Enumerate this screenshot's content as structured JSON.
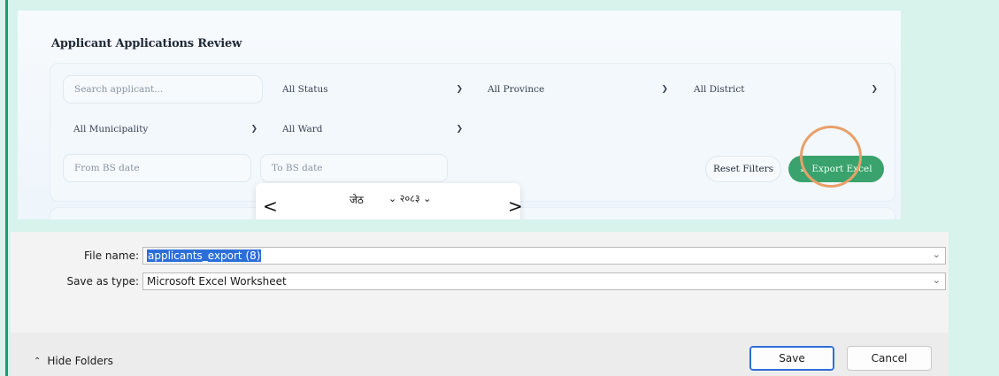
{
  "app": {
    "title": "Applicant Applications Review",
    "search_placeholder": "Search applicant...",
    "filters": {
      "status": "All Status",
      "province": "All Province",
      "district": "All District",
      "municipality": "All Municipality",
      "ward": "All Ward"
    },
    "from_date_placeholder": "From BS date",
    "to_date_placeholder": "To BS date",
    "reset_label": "Reset Filters",
    "export_label": "Export Excel",
    "calendar": {
      "prev": "<",
      "next": ">",
      "month": "जेठ",
      "year": "२०८३"
    }
  },
  "dialog": {
    "file_name_label": "File name:",
    "file_name_value": "applicants_export (8)",
    "save_type_label": "Save as type:",
    "save_type_value": "Microsoft Excel Worksheet",
    "hide_folders_label": "Hide Folders",
    "save_label": "Save",
    "cancel_label": "Cancel"
  },
  "icons": {
    "chevron": "chevron-down-icon",
    "export": "download-icon",
    "hide_folders": "chevron-up-icon"
  },
  "colors": {
    "accent_green": "#3aa26c",
    "highlight_ring": "#e8a06a",
    "selection_blue": "#2c6ed8",
    "page_background": "#d7f3ec"
  }
}
